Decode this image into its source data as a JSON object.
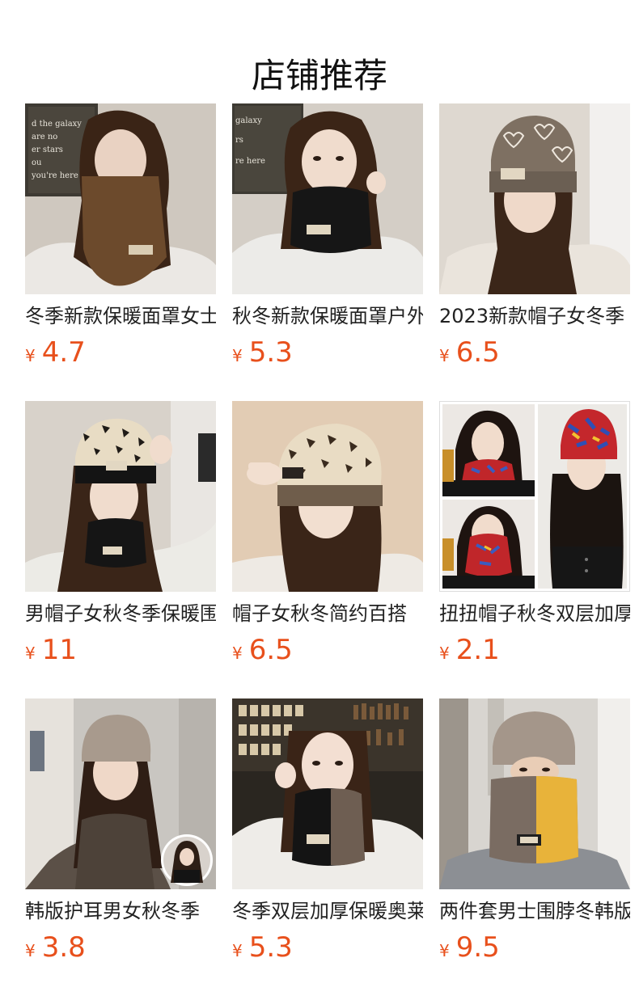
{
  "header": {
    "title": "店铺推荐"
  },
  "colors": {
    "price": "#e8501c",
    "text": "#222222"
  },
  "products": [
    {
      "name": "冬季新款保暖面罩女士",
      "currency": "¥",
      "price": "4.7",
      "image": "woman-brown-face-mask-photo"
    },
    {
      "name": "秋冬新款保暖面罩户外",
      "currency": "¥",
      "price": "5.3",
      "image": "woman-black-neck-gaiter-photo"
    },
    {
      "name": "2023新款帽子女冬季",
      "currency": "¥",
      "price": "6.5",
      "image": "woman-heart-pattern-beanie-photo"
    },
    {
      "name": "男帽子女秋冬季保暖围脖",
      "currency": "¥",
      "price": "11",
      "image": "woman-leopard-beanie-set-photo"
    },
    {
      "name": "帽子女秋冬简约百搭",
      "currency": "¥",
      "price": "6.5",
      "image": "woman-letter-print-beanie-photo"
    },
    {
      "name": "扭扭帽子秋冬双层加厚",
      "currency": "¥",
      "price": "2.1",
      "image": "red-floral-scarf-collage-photo"
    },
    {
      "name": "韩版护耳男女秋冬季",
      "currency": "¥",
      "price": "3.8",
      "image": "woman-taupe-knit-hat-photo"
    },
    {
      "name": "冬季双层加厚保暖奥莱",
      "currency": "¥",
      "price": "5.3",
      "image": "woman-two-tone-gaiter-photo"
    },
    {
      "name": "两件套男士围脖冬韩版",
      "currency": "¥",
      "price": "9.5",
      "image": "man-yellow-gray-gaiter-photo"
    }
  ]
}
